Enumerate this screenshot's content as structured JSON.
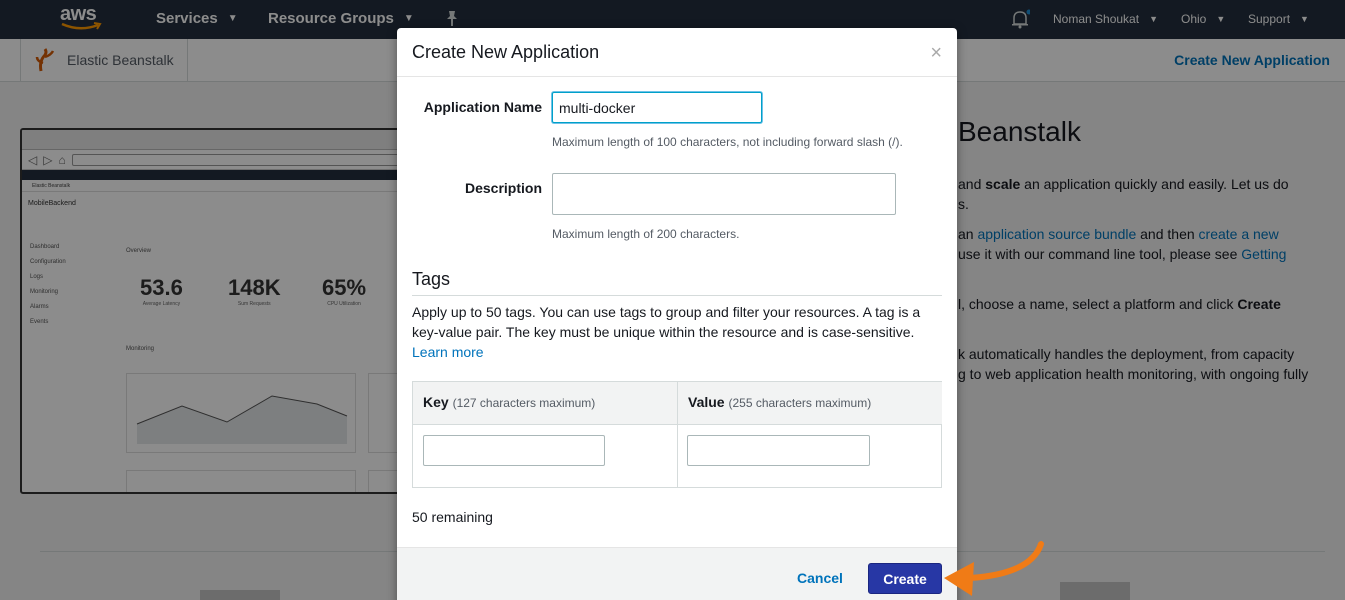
{
  "topnav": {
    "logo": "aws",
    "services_label": "Services",
    "resource_groups_label": "Resource Groups",
    "user_label": "Noman Shoukat",
    "region_label": "Ohio",
    "support_label": "Support"
  },
  "subbar": {
    "service_name": "Elastic Beanstalk",
    "create_link": "Create New Application"
  },
  "background": {
    "heading": "Beanstalk",
    "p1_a": "and ",
    "p1_bold": "scale",
    "p1_b": " an application quickly and easily. Let us do",
    "p1_c": "s.",
    "p2_a": "an ",
    "p2_link": "application source bundle",
    "p2_b": " and then ",
    "p2_link2": "create a new",
    "p2_c": "use it with our command line tool, please see ",
    "p2_link3": "Getting",
    "p3_a": "l, choose a name, select a platform and click ",
    "p3_bold": "Create",
    "p4_a": "k automatically handles the deployment, from capacity",
    "p4_b": "g to web application health monitoring, with ongoing fully",
    "mini": {
      "service": "Elastic Beanstalk",
      "app_title": "MobileBackend",
      "sidebar": [
        "Dashboard",
        "Configuration",
        "Logs",
        "Monitoring",
        "Alarms",
        "Events"
      ],
      "overview": "Overview",
      "metrics": [
        {
          "value": "53.6",
          "label": "Average Latency"
        },
        {
          "value": "148K",
          "label": "Sum Requests"
        },
        {
          "value": "65%",
          "label": "CPU Utilization"
        }
      ],
      "monitoring": "Monitoring"
    }
  },
  "modal": {
    "title": "Create New Application",
    "close_glyph": "×",
    "app_name_label": "Application Name",
    "app_name_value": "multi-docker",
    "app_name_hint": "Maximum length of 100 characters, not including forward slash (/).",
    "description_label": "Description",
    "description_value": "",
    "description_hint": "Maximum length of 200 characters.",
    "tags_title": "Tags",
    "tags_desc": "Apply up to 50 tags. You can use tags to group and filter your resources. A tag is a key-value pair. The key must be unique within the resource and is case-sensitive.",
    "learn_more": "Learn more",
    "key_header": "Key",
    "key_sub": "(127 characters maximum)",
    "value_header": "Value",
    "value_sub": "(255 characters maximum)",
    "remaining": "50 remaining",
    "cancel_label": "Cancel",
    "create_label": "Create"
  },
  "colors": {
    "nav_bg": "#232f3e",
    "link": "#0073bb",
    "primary_button": "#2737a5",
    "annotation_arrow": "#f07b16"
  },
  "icons": {
    "notification": "bell-icon",
    "pin": "pin-icon",
    "service": "beanstalk-icon",
    "arrow": "annotation-arrow-icon"
  }
}
